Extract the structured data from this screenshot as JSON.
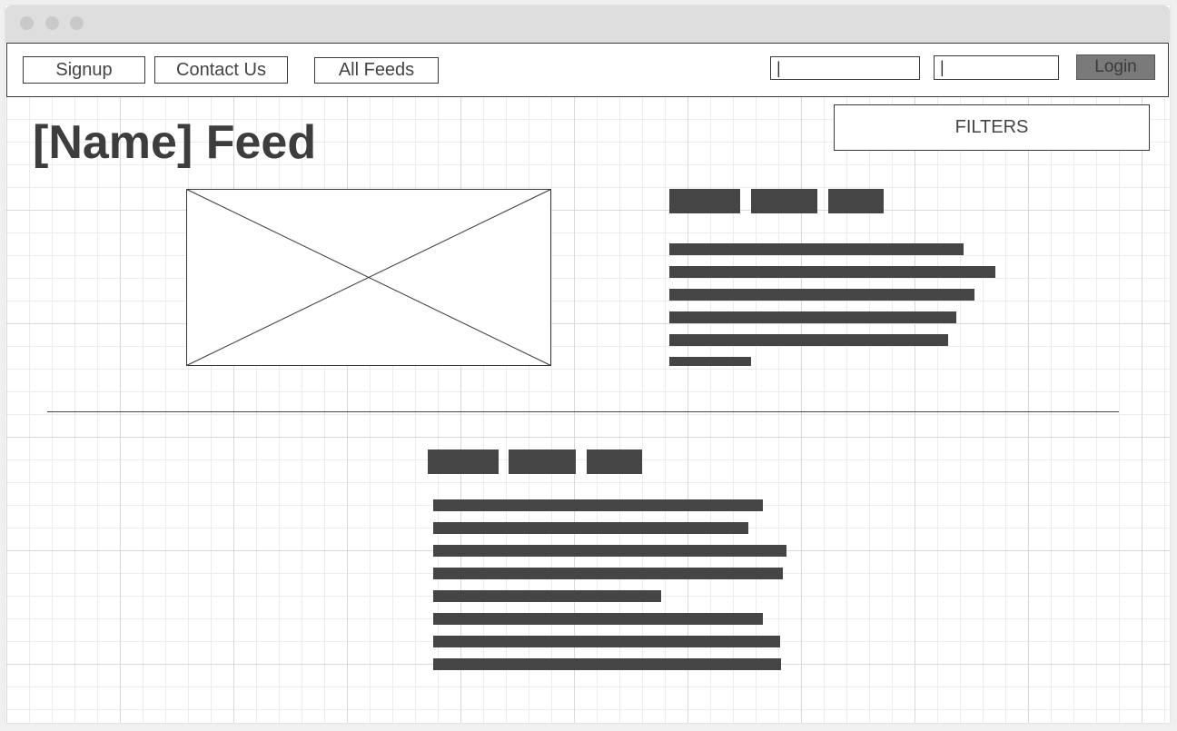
{
  "page": {
    "heading": "[Name] Feed"
  },
  "nav": {
    "signup_label": "Signup",
    "contact_label": "Contact Us",
    "feeds_label": "All Feeds",
    "username_value": "|",
    "password_value": "|",
    "login_label": "Login"
  },
  "filters": {
    "label": "FILTERS"
  },
  "colors": {
    "wireframe_fill": "#454545",
    "login_button": "#7a7a7a",
    "titlebar": "#dedede"
  }
}
